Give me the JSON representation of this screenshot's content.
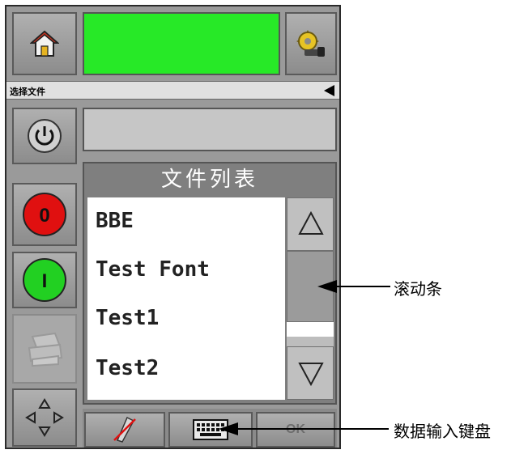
{
  "header": {
    "home_icon": "home-icon",
    "settings_icon": "gear-settings-icon",
    "status_color": "#27e927"
  },
  "title_bar": {
    "label": "选择文件"
  },
  "side_buttons": {
    "power_icon": "power-icon",
    "stop_label": "0",
    "start_label": "I",
    "printer_icon": "printer-icon",
    "nav_icon": "direction-pad-icon"
  },
  "file_list": {
    "title": "文件列表",
    "items": [
      "BBE",
      "Test Font",
      "Test1",
      "Test2"
    ]
  },
  "bottom_bar": {
    "ok_label": "OK",
    "no_edit_icon": "pen-crossed-icon",
    "keyboard_icon": "keyboard-icon"
  },
  "callouts": {
    "scrollbar": "滚动条",
    "keyboard": "数据输入键盘"
  },
  "colors": {
    "stop": "#e01010",
    "start": "#22d022",
    "panel": "#9a9a9a"
  }
}
